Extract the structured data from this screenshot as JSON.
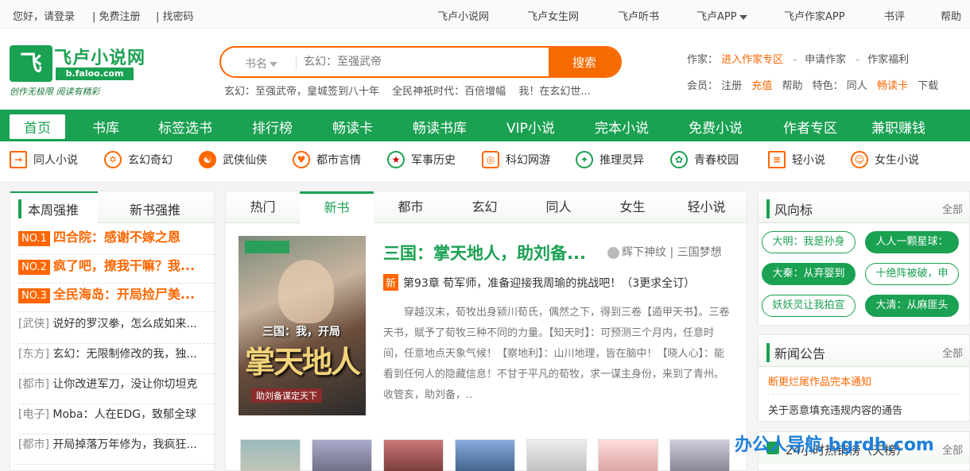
{
  "topbar": {
    "login": "您好，请登录",
    "register": "| 免费注册",
    "forgot": "| 找密码",
    "links": [
      "飞卢小说网",
      "飞卢女生网",
      "飞卢听书",
      "飞卢APP",
      "飞卢作家APP",
      "书评",
      "帮助"
    ]
  },
  "logo": {
    "mark": "飞",
    "title": "飞卢小说网",
    "url": "b.faloo.com",
    "slogan": "创作无极限  阅读有精彩"
  },
  "search": {
    "category": "书名",
    "placeholder": "玄幻：至强武帝",
    "button": "搜索",
    "hot": [
      "玄幻：至强武帝，皇城签到八十年",
      "全民神祇时代：百倍增幅",
      "我！在玄幻世..."
    ]
  },
  "right_info": {
    "author_label": "作家：",
    "author_zone": "进入作家专区",
    "apply": "申请作家",
    "welfare": "作家福利",
    "member_label": "会员：",
    "signup": "注册",
    "recharge": "充值",
    "help": "帮助",
    "feature_label": "特色：",
    "tongren": "同人",
    "card": "畅读卡",
    "download": "下载"
  },
  "main_nav": [
    "首页",
    "书库",
    "标签选书",
    "排行榜",
    "畅读卡",
    "畅读书库",
    "VIP小说",
    "完本小说",
    "免费小说",
    "作者专区",
    "兼职赚钱"
  ],
  "category_nav": [
    {
      "label": "同人小说",
      "icon": "book-arrow-icon",
      "glyph": "→"
    },
    {
      "label": "玄幻奇幻",
      "icon": "star-icon",
      "glyph": "✡"
    },
    {
      "label": "武侠仙侠",
      "icon": "yin-yang-icon",
      "glyph": "☯"
    },
    {
      "label": "都市言情",
      "icon": "heart-icon",
      "glyph": "♥"
    },
    {
      "label": "军事历史",
      "icon": "medal-icon",
      "glyph": "★"
    },
    {
      "label": "科幻网游",
      "icon": "gamepad-icon",
      "glyph": "◎"
    },
    {
      "label": "推理灵异",
      "icon": "ghost-icon",
      "glyph": "✦"
    },
    {
      "label": "青春校园",
      "icon": "candy-icon",
      "glyph": "✿"
    },
    {
      "label": "轻小说",
      "icon": "sliders-icon",
      "glyph": "≡"
    },
    {
      "label": "女生小说",
      "icon": "girl-icon",
      "glyph": "☺"
    }
  ],
  "left_panel": {
    "tabs": [
      "本周强推",
      "新书强推"
    ],
    "top": [
      {
        "badge": "NO.1",
        "title": "四合院：感谢不嫁之恩"
      },
      {
        "badge": "NO.2",
        "title": "疯了吧，撩我干嘛？我..."
      },
      {
        "badge": "NO.3",
        "title": "全民海岛：开局捡尸美..."
      }
    ],
    "items": [
      {
        "tag": "[武侠]",
        "title": "说好的罗汉拳，怎么成如来..."
      },
      {
        "tag": "[东方]",
        "title": "玄幻：无限制修改的我，独..."
      },
      {
        "tag": "[都市]",
        "title": "让你改进军刀，没让你切坦克"
      },
      {
        "tag": "[电子]",
        "title": "Moba：人在EDG，致郁全球"
      },
      {
        "tag": "[都市]",
        "title": "开局掉落万年修为，我疯狂..."
      }
    ]
  },
  "center_panel": {
    "tabs": [
      "热门",
      "新书",
      "都市",
      "玄幻",
      "同人",
      "女生",
      "轻小说"
    ],
    "active_tab": 1,
    "cover": {
      "line1": "三国：我，开局",
      "line2": "掌天地人",
      "line3": "助刘备谋定天下"
    },
    "book_title": "三国：掌天地人，助刘备...",
    "author": "辉下神纹",
    "category": "| 三国梦想",
    "new_badge": "新",
    "chapter": "第93章 荀军师，准备迎接我周瑜的挑战吧！（3更求全订）",
    "description": "穿越汉末，荀牧出身颍川荀氏，偶然之下，得到三卷【遁甲天书】。三卷天书，赋予了荀牧三种不同的力量。【知天时】：可预测三个月内，任意时间，任意地点天象气候！【察地利】：山川地理，皆在脑中！【晓人心】：能看到任何人的隐藏信息！不甘于平凡的荀牧，求一谋主身份，来到了青州。收管亥，助刘备，.."
  },
  "right_panel": {
    "trend": {
      "title": "风向标",
      "all": "全部",
      "pills": [
        "大明：我是孙身",
        "人人一颗星球：",
        "大秦：从弃婴到",
        "十绝阵被破，申",
        "妖妖灵让我拍宣",
        "大清：从麻匪头"
      ]
    },
    "news": {
      "title": "新闻公告",
      "all": "全部",
      "items": [
        "断更烂尾作品完本通知",
        "关于恶意填充违规内容的通告"
      ]
    },
    "hot24": {
      "title": "24小时热销榜（天榜）",
      "all": "全部"
    }
  },
  "watermark": "办公人导航 bgrdh.com",
  "colors": {
    "brand_green": "#1aa152",
    "accent_orange": "#f66a00"
  }
}
